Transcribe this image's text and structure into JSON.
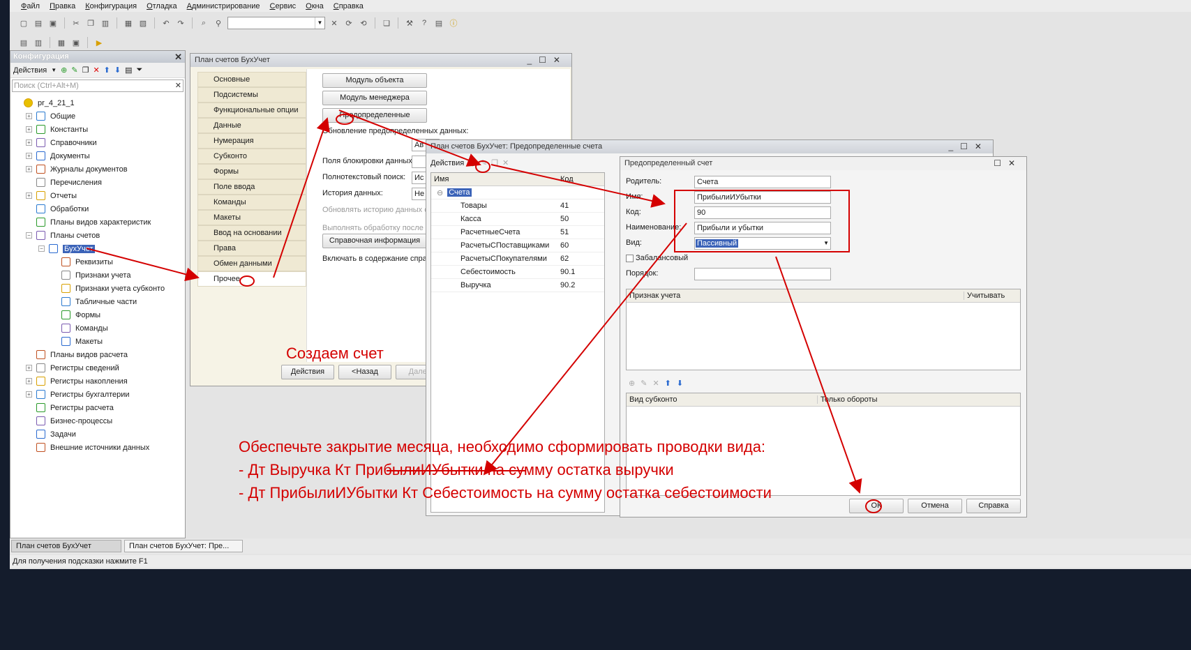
{
  "menu": [
    "Файл",
    "Правка",
    "Конфигурация",
    "Отладка",
    "Администрирование",
    "Сервис",
    "Окна",
    "Справка"
  ],
  "config_panel": {
    "title": "Конфигурация",
    "actions_label": "Действия",
    "search_placeholder": "Поиск (Ctrl+Alt+M)",
    "tree": [
      {
        "label": "pr_4_21_1",
        "level": 0,
        "exp": ""
      },
      {
        "label": "Общие",
        "level": 1,
        "exp": "+"
      },
      {
        "label": "Константы",
        "level": 1,
        "exp": "+"
      },
      {
        "label": "Справочники",
        "level": 1,
        "exp": "+"
      },
      {
        "label": "Документы",
        "level": 1,
        "exp": "+"
      },
      {
        "label": "Журналы документов",
        "level": 1,
        "exp": "+"
      },
      {
        "label": "Перечисления",
        "level": 1,
        "exp": ""
      },
      {
        "label": "Отчеты",
        "level": 1,
        "exp": "+"
      },
      {
        "label": "Обработки",
        "level": 1,
        "exp": ""
      },
      {
        "label": "Планы видов характеристик",
        "level": 1,
        "exp": ""
      },
      {
        "label": "Планы счетов",
        "level": 1,
        "exp": "−"
      },
      {
        "label": "БухУчет",
        "level": 2,
        "exp": "−",
        "selected": true
      },
      {
        "label": "Реквизиты",
        "level": 3,
        "exp": ""
      },
      {
        "label": "Признаки учета",
        "level": 3,
        "exp": ""
      },
      {
        "label": "Признаки учета субконто",
        "level": 3,
        "exp": ""
      },
      {
        "label": "Табличные части",
        "level": 3,
        "exp": ""
      },
      {
        "label": "Формы",
        "level": 3,
        "exp": ""
      },
      {
        "label": "Команды",
        "level": 3,
        "exp": ""
      },
      {
        "label": "Макеты",
        "level": 3,
        "exp": ""
      },
      {
        "label": "Планы видов расчета",
        "level": 1,
        "exp": ""
      },
      {
        "label": "Регистры сведений",
        "level": 1,
        "exp": "+"
      },
      {
        "label": "Регистры накопления",
        "level": 1,
        "exp": "+"
      },
      {
        "label": "Регистры бухгалтерии",
        "level": 1,
        "exp": "+"
      },
      {
        "label": "Регистры расчета",
        "level": 1,
        "exp": ""
      },
      {
        "label": "Бизнес-процессы",
        "level": 1,
        "exp": ""
      },
      {
        "label": "Задачи",
        "level": 1,
        "exp": ""
      },
      {
        "label": "Внешние источники данных",
        "level": 1,
        "exp": ""
      }
    ]
  },
  "plan_window": {
    "title": "План счетов БухУчет",
    "tabs": [
      "Основные",
      "Подсистемы",
      "Функциональные опции",
      "Данные",
      "Нумерация",
      "Субконто",
      "Формы",
      "Поле ввода",
      "Команды",
      "Макеты",
      "Ввод на основании",
      "Права",
      "Обмен данными",
      "Прочее"
    ],
    "btn_object_module": "Модуль объекта",
    "btn_manager_module": "Модуль менеджера",
    "btn_predefined": "Предопределенные",
    "lbl_update": "Обновление предопределенных данных:",
    "lbl_lock_fields": "Поля блокировки данных:",
    "lbl_fulltext": "Полнотекстовый поиск:",
    "lbl_history": "История данных:",
    "lbl_update_history": "Обновлять историю данных с",
    "lbl_process": "Выполнять обработку после з",
    "btn_help_info": "Справочная информация",
    "lbl_include": "Включать в содержание справ",
    "val_update": "Ав",
    "val_fulltext": "Ис",
    "val_history": "Не",
    "btn_actions": "Действия",
    "btn_back": "<Назад",
    "btn_next": "Далее>"
  },
  "predef_window": {
    "title": "План счетов БухУчет: Предопределенные счета",
    "actions_label": "Действия",
    "col_name": "Имя",
    "col_code": "Код",
    "root": "Счета",
    "rows": [
      {
        "name": "Товары",
        "code": "41"
      },
      {
        "name": "Касса",
        "code": "50"
      },
      {
        "name": "РасчетныеСчета",
        "code": "51"
      },
      {
        "name": "РасчетыСПоставщиками",
        "code": "60"
      },
      {
        "name": "РасчетыСПокупателями",
        "code": "62"
      },
      {
        "name": "Себестоимость",
        "code": "90.1"
      },
      {
        "name": "Выручка",
        "code": "90.2"
      }
    ]
  },
  "account_dialog": {
    "title": "Предопределенный счет",
    "lbl_parent": "Родитель:",
    "val_parent": "Счета",
    "lbl_name": "Имя:",
    "val_name": "ПрибылиИУбытки",
    "lbl_code": "Код:",
    "val_code": "90",
    "lbl_desc": "Наименование:",
    "val_desc": "Прибыли и убытки",
    "lbl_kind": "Вид:",
    "val_kind": "Пассивный",
    "lbl_offbalance": "Забалансовый",
    "lbl_order": "Порядок:",
    "col_feature": "Признак учета",
    "col_consider": "Учитывать",
    "col_subconto": "Вид субконто",
    "col_turnover": "Только обороты",
    "btn_ok": "ОК",
    "btn_cancel": "Отмена",
    "btn_help": "Справка"
  },
  "annotations": {
    "create": "Создаем счет",
    "line1": "Обеспечьте закрытие месяца, необходимо сформировать проводки вида:",
    "line2": " - Дт Выручка Кт ПрибылиИУбытки   на сумму остатка выручки",
    "line3": " - Дт ПрибылиИУбытки Кт Себестоимость  на сумму остатка себестоимости",
    "color": "#d40000"
  },
  "taskbar": [
    "План счетов БухУчет",
    "План счетов БухУчет: Пре..."
  ],
  "status": "Для получения подсказки нажмите F1"
}
